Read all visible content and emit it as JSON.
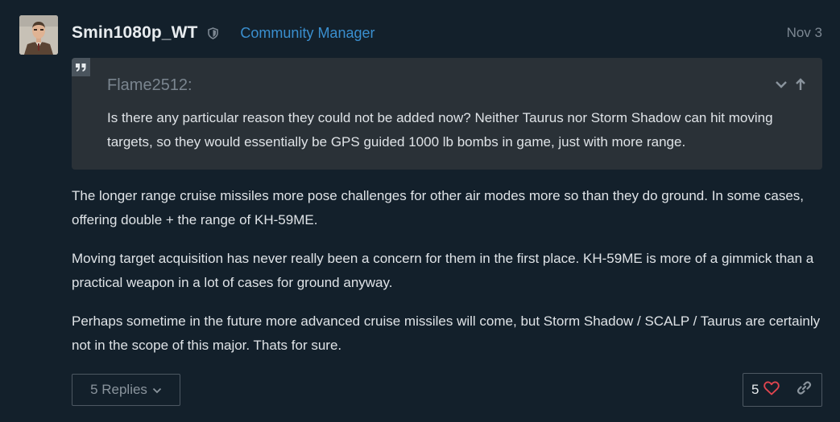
{
  "post": {
    "username": "Smin1080p_WT",
    "role": "Community Manager",
    "date": "Nov 3",
    "avatar_icon": "user-avatar"
  },
  "quote": {
    "author": "Flame2512:",
    "text": "Is there any particular reason they could not be added now? Neither Taurus nor Storm Shadow can hit moving targets, so they would essentially be GPS guided 1000 lb bombs in game, just with more range."
  },
  "body": {
    "paragraphs": [
      "The longer range cruise missiles more pose challenges for other air modes more so than they do ground. In some cases, offering double + the range of KH-59ME.",
      "Moving target acquisition has never really been a concern for them in the first place. KH-59ME is more of a gimmick than a practical weapon in a lot of cases for ground anyway.",
      "Perhaps sometime in the future more advanced cruise missiles will come, but Storm Shadow / SCALP / Taurus are certainly not in the scope of this major. Thats for sure."
    ]
  },
  "footer": {
    "replies_label": "5 Replies",
    "like_count": "5"
  },
  "colors": {
    "background": "#13202b",
    "quote_bg": "#2a3137",
    "role_link": "#3a8fcf",
    "heart": "#e0454f"
  }
}
